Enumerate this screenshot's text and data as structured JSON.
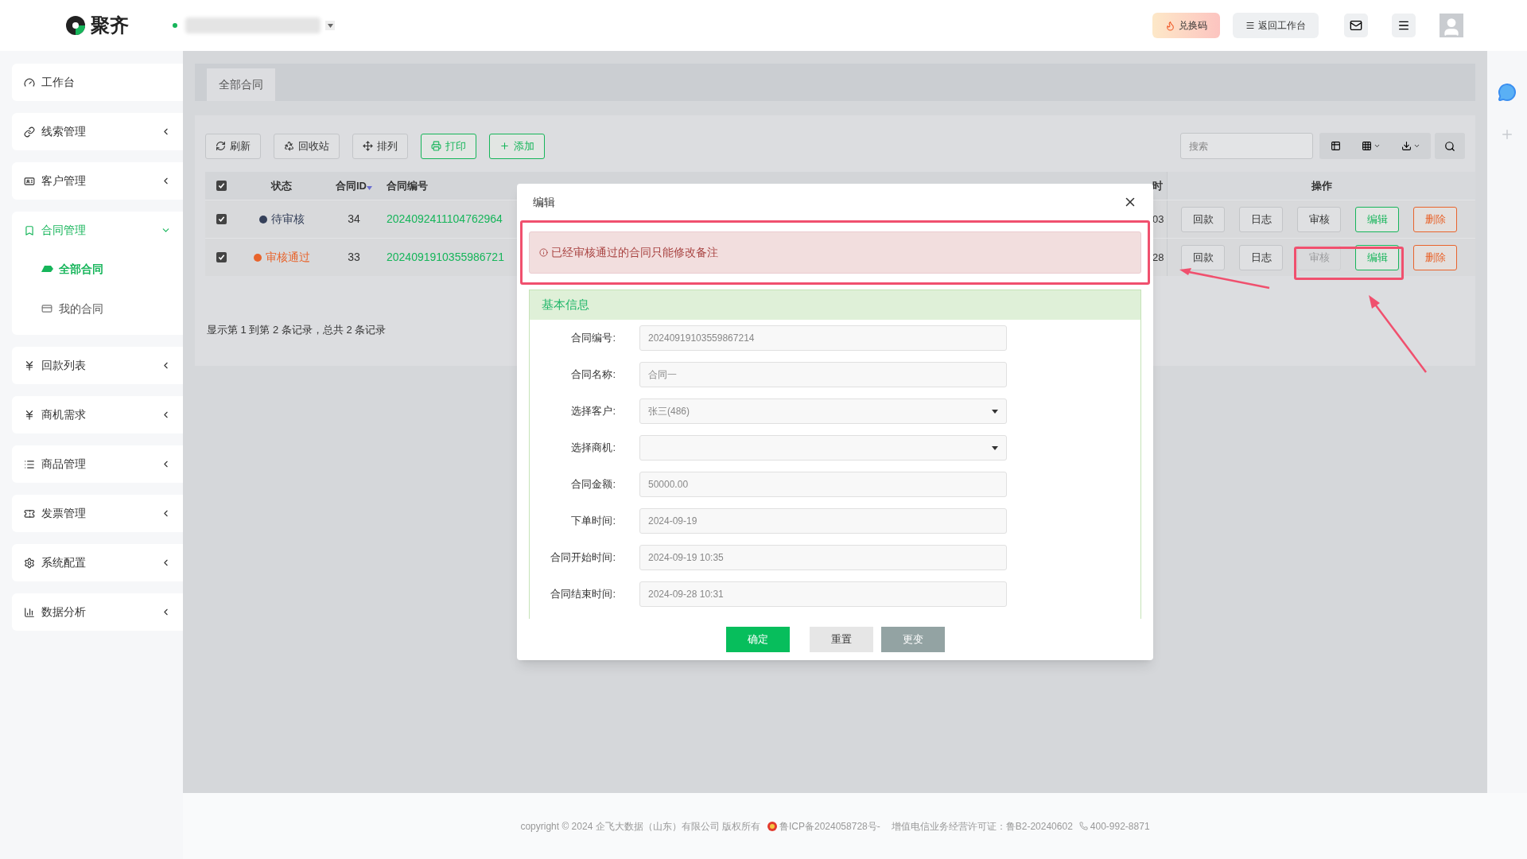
{
  "header": {
    "logo": "聚齐",
    "buttons": [
      {
        "label": "兑换码",
        "kind": "promo"
      },
      {
        "label": "返回工作台",
        "kind": "plain"
      }
    ]
  },
  "sidebar": {
    "items": [
      {
        "label": "工作台",
        "expanded": false,
        "has_children": false
      },
      {
        "label": "线索管理",
        "expanded": false,
        "has_children": true
      },
      {
        "label": "客户管理",
        "expanded": false,
        "has_children": true
      },
      {
        "label": "合同管理",
        "expanded": true,
        "has_children": true,
        "children": [
          {
            "label": "全部合同",
            "selected": true
          },
          {
            "label": "我的合同",
            "selected": false
          }
        ]
      },
      {
        "label": "回款列表",
        "expanded": false,
        "has_children": true
      },
      {
        "label": "商机需求",
        "expanded": false,
        "has_children": true
      },
      {
        "label": "商品管理",
        "expanded": false,
        "has_children": true
      },
      {
        "label": "发票管理",
        "expanded": false,
        "has_children": true
      },
      {
        "label": "系统配置",
        "expanded": false,
        "has_children": true
      },
      {
        "label": "数据分析",
        "expanded": false,
        "has_children": true
      }
    ]
  },
  "tabs": [
    {
      "label": "全部合同",
      "selected": true
    }
  ],
  "toolbar": {
    "buttons": [
      {
        "label": "刷新",
        "kind": "plain"
      },
      {
        "label": "回收站",
        "kind": "plain"
      },
      {
        "label": "排列",
        "kind": "plain"
      },
      {
        "label": "打印",
        "kind": "green"
      },
      {
        "label": "添加",
        "kind": "green"
      }
    ],
    "search": {
      "placeholder": "搜索"
    }
  },
  "table": {
    "all_checked": true,
    "columns": [
      "状态",
      "合同ID",
      "合同编号",
      "",
      "时",
      "操作"
    ],
    "rows": [
      {
        "checked": true,
        "status": "待审核",
        "color": "#35405a",
        "id": "34",
        "number": "2024092411104762964",
        "column_5": "03",
        "actions": [
          {
            "label": "回款",
            "kind": "plain",
            "disabled": false
          },
          {
            "label": "日志",
            "kind": "plain",
            "disabled": false
          },
          {
            "label": "审核",
            "kind": "plain",
            "disabled": false
          },
          {
            "label": "编辑",
            "kind": "green",
            "disabled": false
          },
          {
            "label": "删除",
            "kind": "danger",
            "disabled": false
          }
        ]
      },
      {
        "checked": true,
        "status": "审核通过",
        "color": "#e8642c",
        "id": "33",
        "number": "2024091910355986721",
        "column_5": "28",
        "actions": [
          {
            "label": "回款",
            "kind": "plain",
            "disabled": false
          },
          {
            "label": "日志",
            "kind": "plain",
            "disabled": false
          },
          {
            "label": "审核",
            "kind": "plain",
            "disabled": true
          },
          {
            "label": "编辑",
            "kind": "green",
            "disabled": false
          },
          {
            "label": "删除",
            "kind": "danger",
            "disabled": false
          }
        ]
      }
    ],
    "summary": "显示第 1 到第 2 条记录，总共 2 条记录"
  },
  "modal": {
    "title": "编辑",
    "alert": "已经审核通过的合同只能修改备注",
    "section": "基本信息",
    "fields": [
      {
        "label": "合同编号:",
        "kind": "text",
        "value": "20240919103559867214"
      },
      {
        "label": "合同名称:",
        "kind": "text",
        "value": "合同一"
      },
      {
        "label": "选择客户:",
        "kind": "select",
        "value": "张三(486)"
      },
      {
        "label": "选择商机:",
        "kind": "select"
      },
      {
        "label": "合同金额:",
        "kind": "text",
        "value": "50000.00"
      },
      {
        "label": "下单时间:",
        "kind": "text",
        "value": "2024-09-19"
      },
      {
        "label": "合同开始时间:",
        "kind": "text",
        "value": "2024-09-19 10:35"
      },
      {
        "label": "合同结束时间:",
        "kind": "text",
        "value": "2024-09-28 10:31"
      }
    ],
    "buttons": [
      {
        "label": "确定",
        "kind": "primary"
      },
      {
        "label": "重置",
        "kind": "light"
      },
      {
        "label": "更变",
        "kind": "dark"
      }
    ]
  },
  "footer": {
    "copyright": "copyright © 2024 企飞大数据（山东）有限公司 版权所有",
    "icp": "鲁ICP备2024058728号-",
    "license": "增值电信业务经营许可证：鲁B2-20240602",
    "phone": "400-992-8871"
  }
}
